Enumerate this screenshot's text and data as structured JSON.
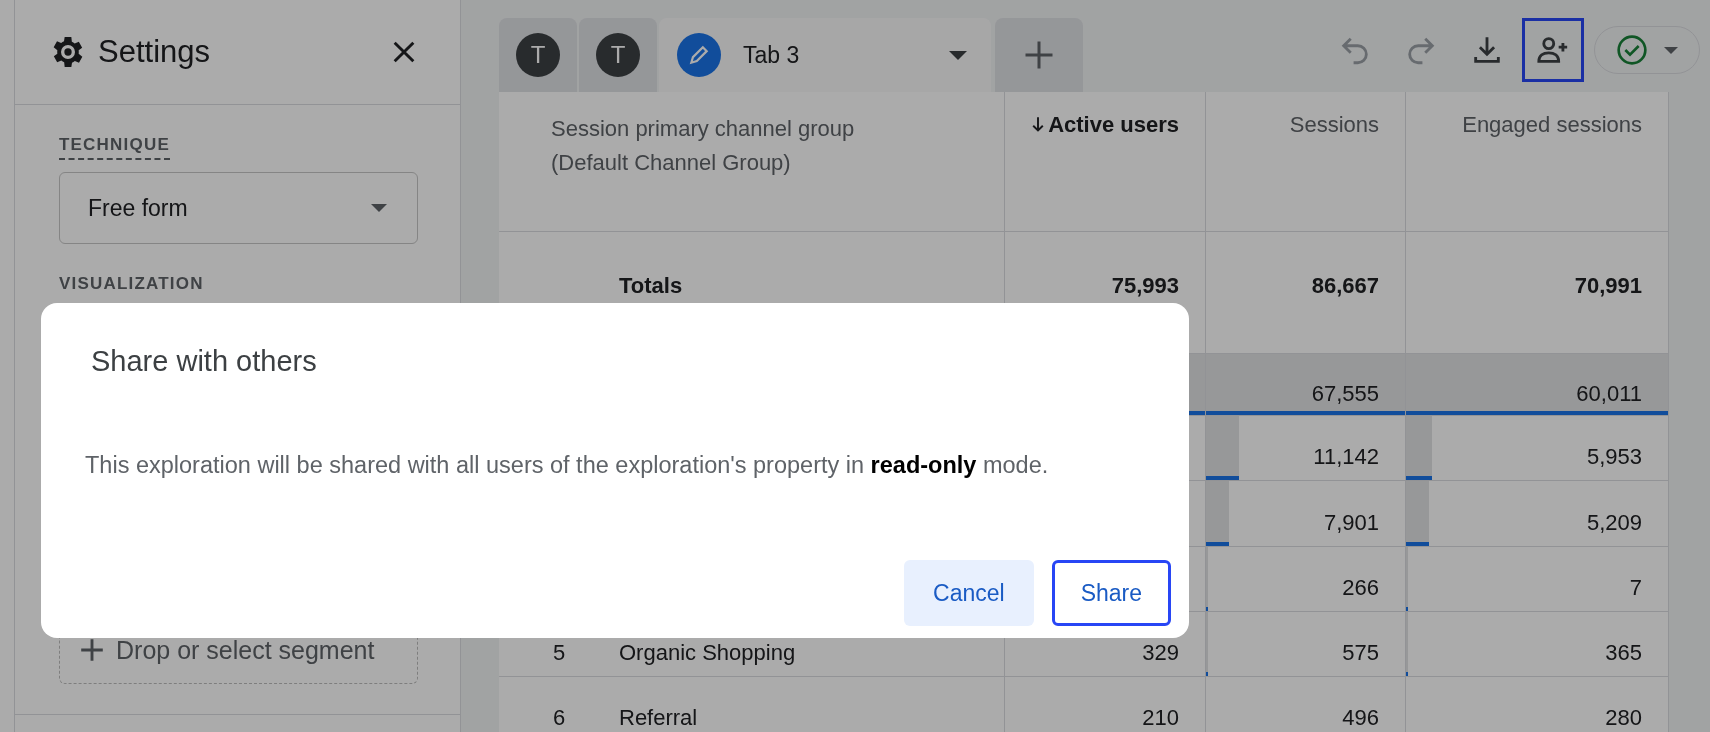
{
  "settings_panel": {
    "title": "Settings",
    "technique_label": "TECHNIQUE",
    "technique_value": "Free form",
    "visualization_label": "VISUALIZATION",
    "segment_button": "Drop or select segment"
  },
  "tabs": [
    {
      "kind": "avatar",
      "label": "T",
      "selected": false
    },
    {
      "kind": "avatar",
      "label": "T",
      "selected": false
    },
    {
      "kind": "named",
      "label": "Tab 3",
      "selected": true
    }
  ],
  "toolbar": [
    {
      "kind": "undo",
      "disabled": true,
      "highlighted": false
    },
    {
      "kind": "redo",
      "disabled": true,
      "highlighted": false
    },
    {
      "kind": "download",
      "disabled": false,
      "highlighted": false
    },
    {
      "kind": "share",
      "disabled": false,
      "highlighted": true
    }
  ],
  "table": {
    "dimension_header": "Session primary channel group (Default Channel Group)",
    "metric_columns": [
      {
        "label": "Active users",
        "sorted": true
      },
      {
        "label": "Sessions",
        "sorted": false
      },
      {
        "label": "Engaged sessions",
        "sorted": false
      }
    ],
    "totals": {
      "label": "Totals",
      "values": [
        "75,993",
        "86,667",
        "70,991"
      ]
    },
    "rows": [
      {
        "active_users": {
          "level": 1
        },
        "sessions": {
          "text": "67,555",
          "level": 1
        },
        "engaged_sessions": {
          "text": "60,011",
          "level": 1
        }
      },
      {
        "sessions": {
          "text": "11,142",
          "level": 0.165
        },
        "engaged_sessions": {
          "text": "5,953",
          "level": 0.099
        }
      },
      {
        "sessions": {
          "text": "7,901",
          "level": 0.117
        },
        "engaged_sessions": {
          "text": "5,209",
          "level": 0.087
        }
      },
      {
        "sessions": {
          "text": "266",
          "level": 0.004
        },
        "engaged_sessions": {
          "text": "7",
          "level": 0.001
        }
      },
      {
        "number": "5",
        "label": "Organic Shopping",
        "active_users": {
          "text": "329"
        },
        "sessions": {
          "text": "575",
          "level": 0.009
        },
        "engaged_sessions": {
          "text": "365",
          "level": 0.006
        }
      },
      {
        "number": "6",
        "label": "Referral",
        "active_users": {
          "text": "210"
        },
        "sessions": {
          "text": "496"
        },
        "engaged_sessions": {
          "text": "280"
        }
      }
    ]
  },
  "dialog": {
    "title": "Share with others",
    "message": "This exploration will be shared with all users of the exploration's property in **read-only** mode.",
    "buttons": [
      {
        "label": "Cancel",
        "kind": "secondary",
        "highlighted": false
      },
      {
        "label": "Share",
        "kind": "primary",
        "highlighted": true
      }
    ]
  }
}
